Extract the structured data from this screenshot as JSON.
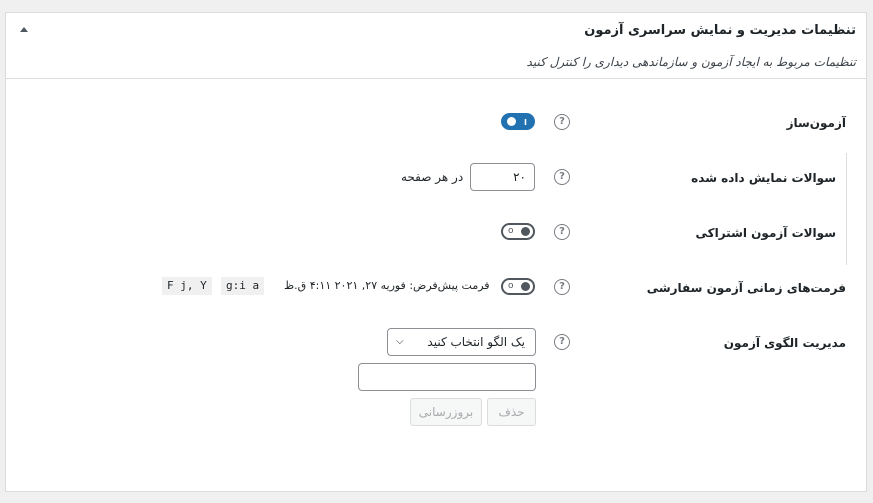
{
  "panel": {
    "title": "تنظیمات مدیریت و نمایش سراسری آزمون",
    "description": "تنظیمات مربوط به ایجاد آزمون و سازماندهی دیداری را کنترل کنید"
  },
  "help_icon": "?",
  "rows": {
    "quiz_builder": {
      "label": "آزمون‌ساز",
      "enabled": true,
      "toggle_mark": "I"
    },
    "questions_displayed": {
      "label": "سوالات نمایش داده شده",
      "value": "۲۰",
      "suffix": "در هر صفحه"
    },
    "shared_questions": {
      "label": "سوالات آزمون اشتراکی",
      "enabled": false,
      "toggle_mark": "o"
    },
    "custom_date_formats": {
      "label": "فرمت‌های زمانی آزمون سفارشی",
      "enabled": false,
      "toggle_mark": "o",
      "default_format_text": "فرمت پیش‌فرض: فوریه ۲۷, ۲۰۲۱ ۴:۱۱ ق.ظ",
      "time_format_code": "g:i a",
      "date_format_code": "F j, Y"
    },
    "template_management": {
      "label": "مدیریت الگوی آزمون",
      "select_value": "یک الگو انتخاب کنید",
      "name_input_value": "",
      "delete_label": "حذف",
      "update_label": "بروزرسانی"
    }
  }
}
